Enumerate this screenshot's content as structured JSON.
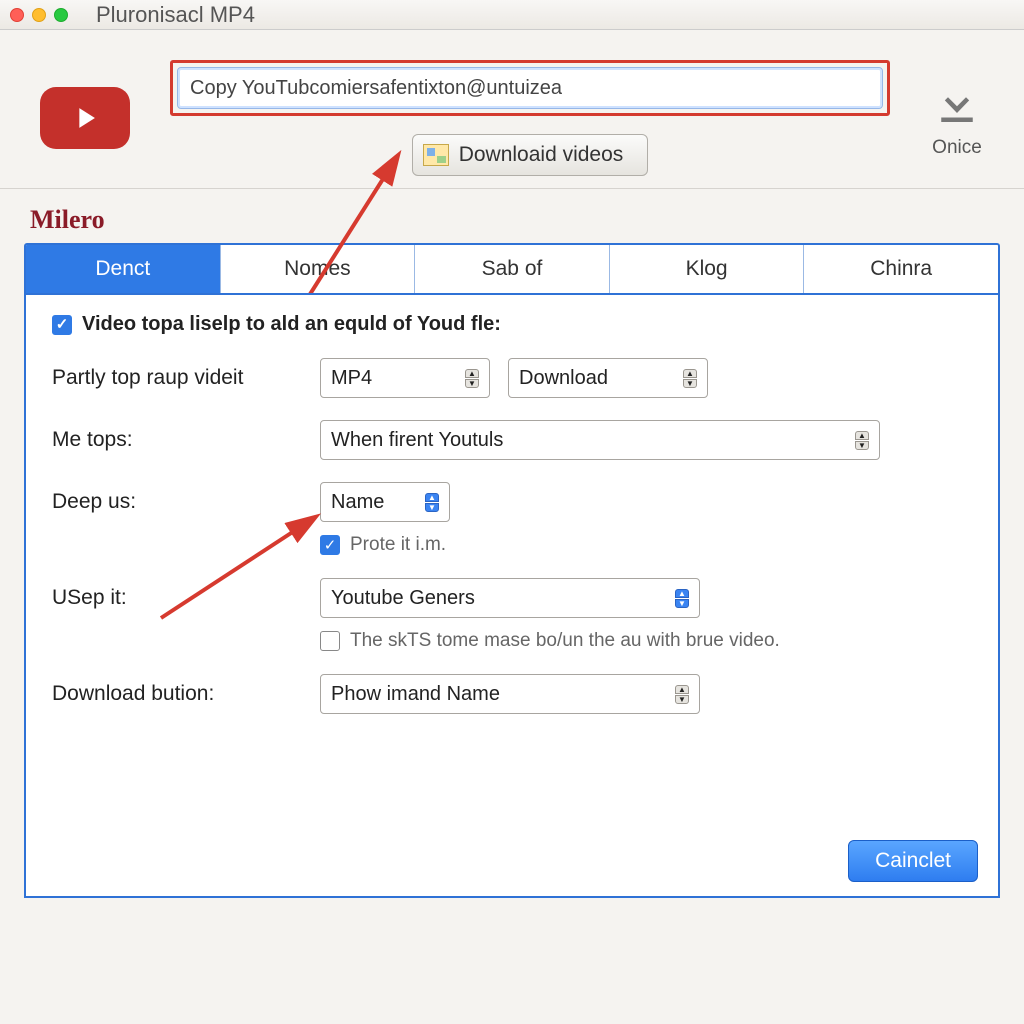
{
  "window": {
    "title": "Pluronisacl MP4"
  },
  "top": {
    "url_value": "Copy YouTubcomiersafentixton@untuizea",
    "download_btn": "Downloaid videos",
    "onice_label": "Onice"
  },
  "heading": "Milero",
  "tabs": [
    "Denct",
    "Nomes",
    "Sab of",
    "Klog",
    "Chinra"
  ],
  "panel": {
    "top_checkbox_label": "Video topa liselp to ald an equld of Youd fle:",
    "row1_label": "Partly top raup videit",
    "row1_format": "MP4",
    "row1_action": "Download",
    "row2_label": "Me tops:",
    "row2_value": "When firent Youtuls",
    "row3_label": "Deep us:",
    "row3_value": "Name",
    "row3_sub_checkbox": "Prote it i.m.",
    "row4_label": "USep it:",
    "row4_value": "Youtube Geners",
    "row4_sub_checkbox": "The skTS tome mase bo/un the au with brue video.",
    "row5_label": "Download bution:",
    "row5_value": "Phow imand Name"
  },
  "footer": {
    "cancel": "Cainclet"
  }
}
